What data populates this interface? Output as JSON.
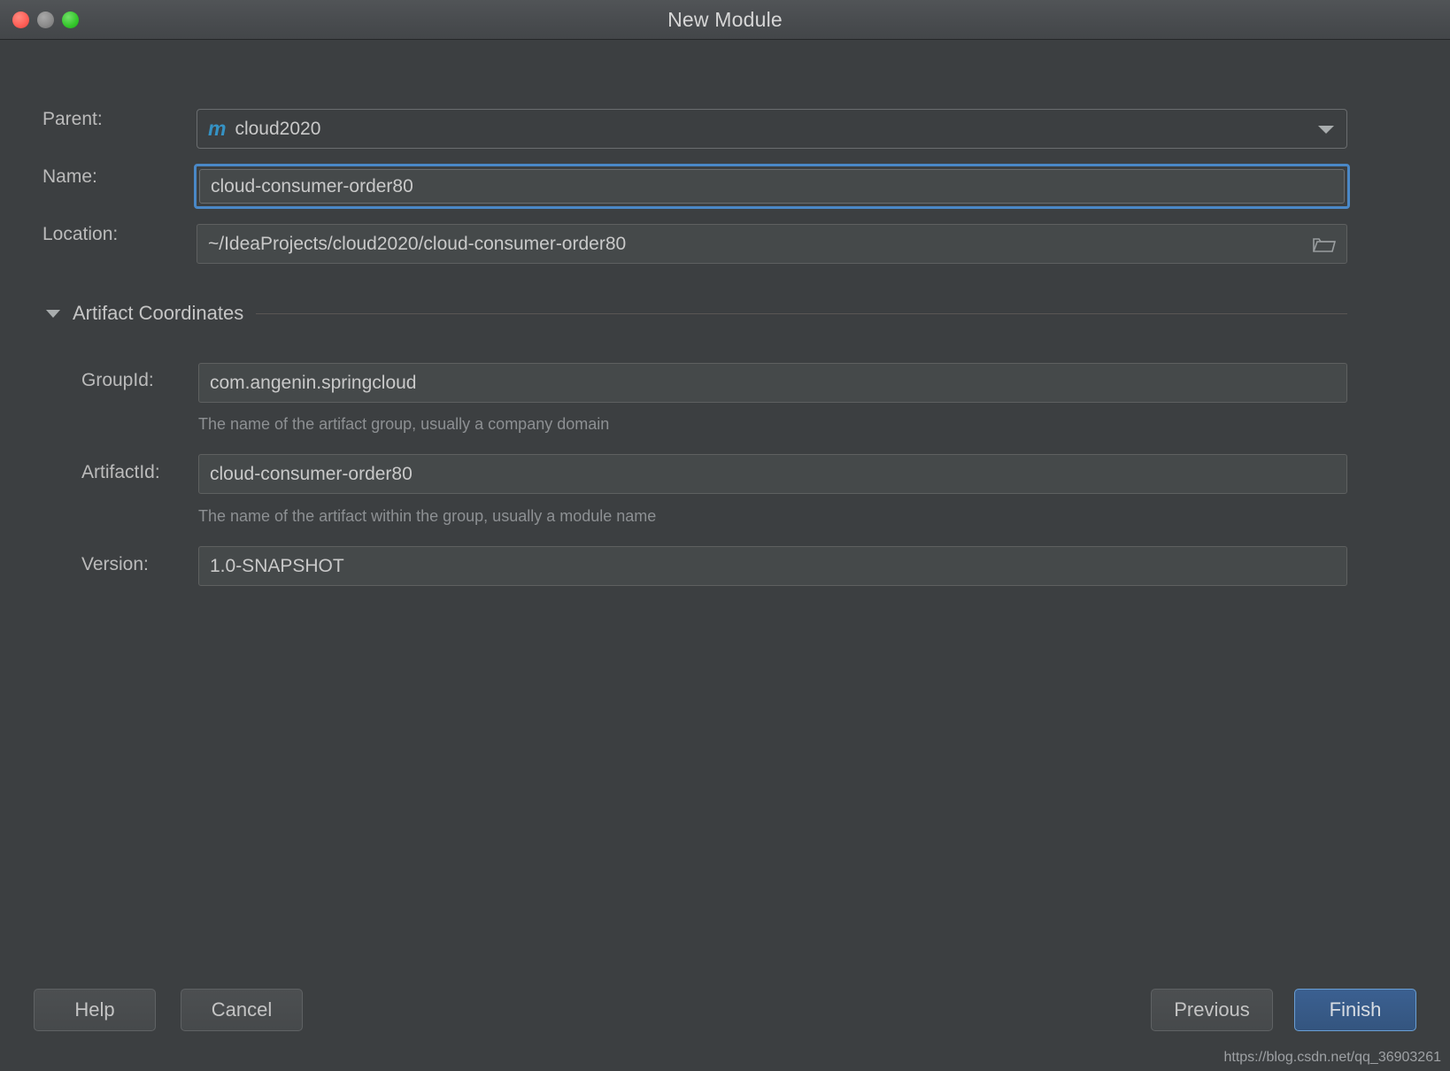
{
  "window": {
    "title": "New Module",
    "traffic_lights": {
      "close": "close-button",
      "minimize": "minimize-button",
      "maximize": "maximize-button"
    }
  },
  "form": {
    "parent": {
      "label": "Parent:",
      "value": "cloud2020",
      "icon": "maven-module-icon",
      "icon_glyph": "m",
      "dropdown_icon": "chevron-down-icon"
    },
    "name": {
      "label": "Name:",
      "value": "cloud-consumer-order80",
      "focused": true
    },
    "location": {
      "label": "Location:",
      "value": "~/IdeaProjects/cloud2020/cloud-consumer-order80",
      "browse_icon": "folder-icon"
    }
  },
  "artifact_section": {
    "title": "Artifact Coordinates",
    "expanded": true,
    "twisty_icon": "triangle-down-icon",
    "fields": {
      "group_id": {
        "label": "GroupId:",
        "value": "com.angenin.springcloud",
        "hint": "The name of the artifact group, usually a company domain"
      },
      "artifact_id": {
        "label": "ArtifactId:",
        "value": "cloud-consumer-order80",
        "hint": "The name of the artifact within the group, usually a module name"
      },
      "version": {
        "label": "Version:",
        "value": "1.0-SNAPSHOT"
      }
    }
  },
  "footer": {
    "help_label": "Help",
    "cancel_label": "Cancel",
    "previous_label": "Previous",
    "finish_label": "Finish"
  },
  "watermark": "https://blog.csdn.net/qq_36903261",
  "colors": {
    "background": "#3c3f41",
    "field_background": "#45494a",
    "accent_focus": "#4a88c7",
    "primary_button": "#365880",
    "maven_icon": "#3592c4",
    "text": "#c9c9c9",
    "hint_text": "#8d9093"
  }
}
